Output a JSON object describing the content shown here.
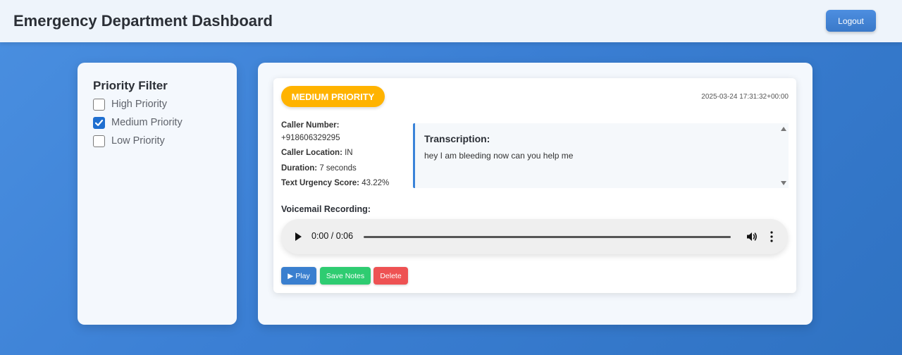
{
  "header": {
    "title": "Emergency Department Dashboard",
    "logout_label": "Logout"
  },
  "filter": {
    "title": "Priority Filter",
    "options": [
      {
        "label": "High Priority",
        "checked": false
      },
      {
        "label": "Medium Priority",
        "checked": true
      },
      {
        "label": "Low Priority",
        "checked": false
      }
    ]
  },
  "call": {
    "priority_badge": "MEDIUM PRIORITY",
    "priority_color": "#ffb300",
    "timestamp": "2025-03-24 17:31:32+00:00",
    "caller_number_label": "Caller Number:",
    "caller_number": "+918606329295",
    "caller_location_label": "Caller Location:",
    "caller_location": "IN",
    "duration_label": "Duration:",
    "duration": "7 seconds",
    "urgency_label": "Text Urgency Score:",
    "urgency": "43.22%",
    "transcription_title": "Transcription:",
    "transcription_text": "hey I am bleeding now can you help me",
    "voicemail_label": "Voicemail Recording:",
    "audio_time": "0:00 / 0:06",
    "audio_progress": 0
  },
  "actions": {
    "play_label": "▶ Play",
    "save_label": "Save Notes",
    "delete_label": "Delete"
  },
  "colors": {
    "accent": "#3a7fcf",
    "save": "#2ecc71",
    "delete": "#ee5253"
  }
}
